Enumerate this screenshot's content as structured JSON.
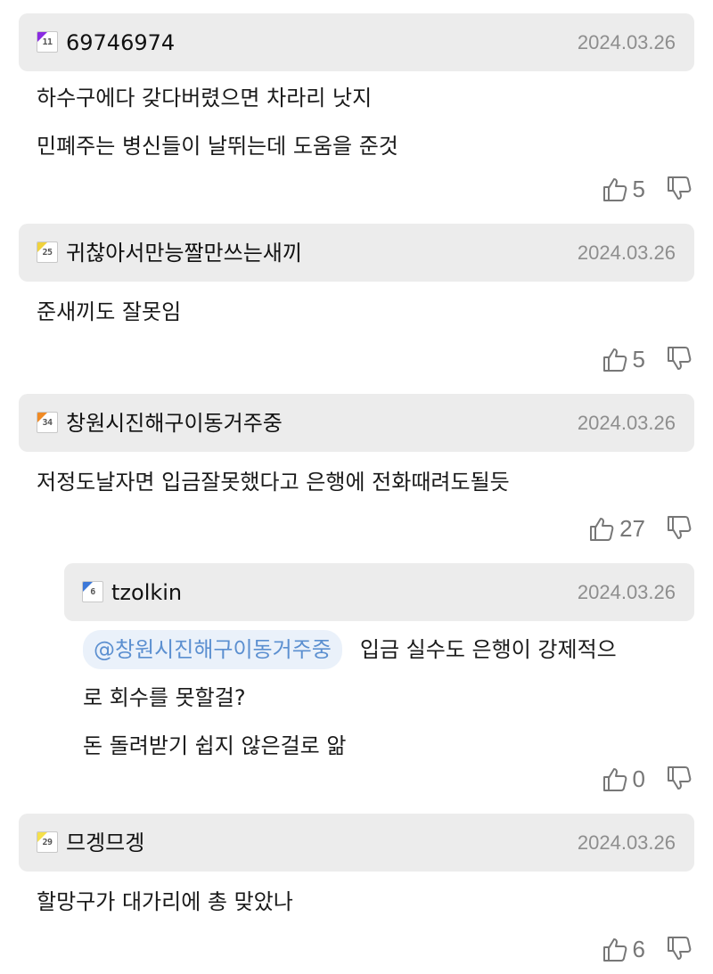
{
  "comments": [
    {
      "username": "69746974",
      "level": "11",
      "level_color": "#8a2be2",
      "date": "2024.03.26",
      "lines": [
        "하수구에다 갖다버렸으면 차라리 낫지",
        "민폐주는 병신들이 날뛰는데 도움을 준것"
      ],
      "likes": "5"
    },
    {
      "username": "귀찮아서만능짤만쓰는새끼",
      "level": "25",
      "level_color": "#f0d23c",
      "date": "2024.03.26",
      "lines": [
        "준새끼도 잘못임"
      ],
      "likes": "5"
    },
    {
      "username": "창원시진해구이동거주중",
      "level": "34",
      "level_color": "#f08a24",
      "date": "2024.03.26",
      "lines": [
        "저정도날자면 입금잘못했다고 은행에 전화때려도될듯"
      ],
      "likes": "27"
    },
    {
      "username": "tzolkin",
      "level": "6",
      "level_color": "#3c78d8",
      "date": "2024.03.26",
      "mention": "@창원시진해구이동거주중",
      "lines": [
        "입금 실수도 은행이 강제적으",
        "로 회수를 못할걸?",
        "돈 돌려받기 쉽지 않은걸로 앎"
      ],
      "likes": "0"
    },
    {
      "username": "므겡므겡",
      "level": "29",
      "level_color": "#f5e04a",
      "date": "2024.03.26",
      "lines": [
        "할망구가 대가리에 총 맞았나"
      ],
      "likes": "6"
    }
  ],
  "icons": {
    "like": "thumbs-up-icon",
    "dislike": "thumbs-down-icon"
  }
}
